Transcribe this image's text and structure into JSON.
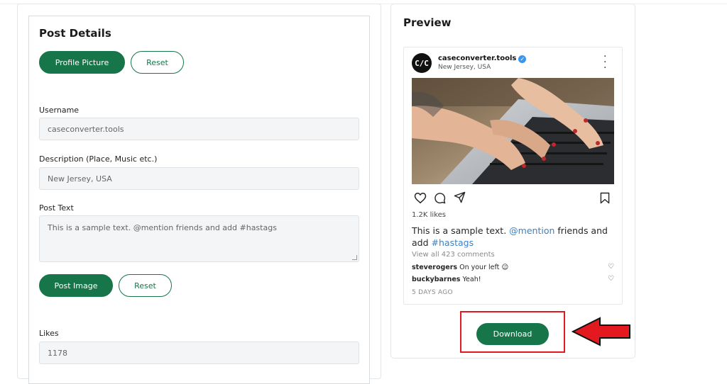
{
  "post_details": {
    "title": "Post Details",
    "profile_picture_button": "Profile Picture",
    "reset_profile_button": "Reset",
    "username_label": "Username",
    "username_value": "caseconverter.tools",
    "description_label": "Description (Place, Music etc.)",
    "description_value": "New Jersey, USA",
    "post_text_label": "Post Text",
    "post_text_value": "This is a sample text. @mention friends and add #hastags",
    "post_image_button": "Post Image",
    "reset_image_button": "Reset",
    "likes_label": "Likes",
    "likes_value": "1178"
  },
  "preview": {
    "title": "Preview",
    "avatar_text": "C/C",
    "username": "caseconverter.tools",
    "verified_icon": "check",
    "location": "New Jersey, USA",
    "likes": "1.2K likes",
    "caption_plain_1": "This is a sample text.",
    "caption_mention": "@mention",
    "caption_plain_2": "friends and add",
    "caption_hashtag": "#hastags",
    "view_all": "View all 423 comments",
    "comments": [
      {
        "user": "steverogers",
        "text": "On your left 😉"
      },
      {
        "user": "buckybarnes",
        "text": "Yeah!"
      }
    ],
    "time_ago": "5 DAYS AGO",
    "download_button": "Download"
  },
  "colors": {
    "accent": "#17754a",
    "link": "#3b82c4",
    "highlight": "#e4191f"
  }
}
